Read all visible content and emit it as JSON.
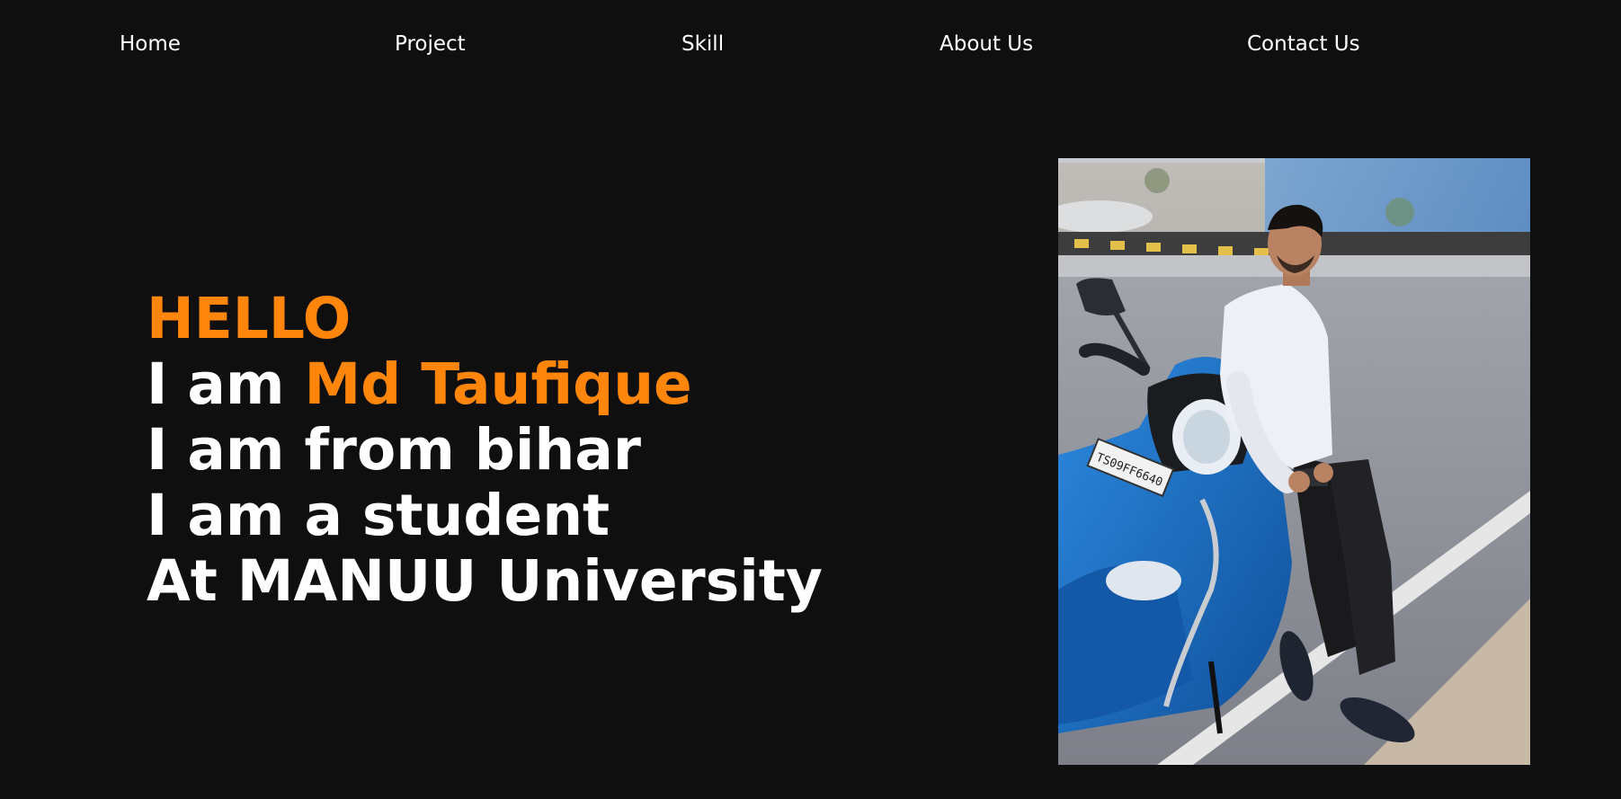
{
  "nav": {
    "items": [
      {
        "label": "Home"
      },
      {
        "label": "Project"
      },
      {
        "label": "Skill"
      },
      {
        "label": "About Us"
      },
      {
        "label": "Contact Us"
      }
    ]
  },
  "hero": {
    "greeting": "HELLO",
    "name_prefix": "I am ",
    "name": "Md Taufique",
    "line_origin": "I am from bihar",
    "line_role": "I am a student",
    "line_university": "At MANUU University"
  },
  "photo": {
    "plate_text": "TS09FF6640"
  },
  "colors": {
    "background": "#100f10",
    "text": "#ffffff",
    "accent": "#ff850b",
    "scooter": "#1f73c9"
  }
}
